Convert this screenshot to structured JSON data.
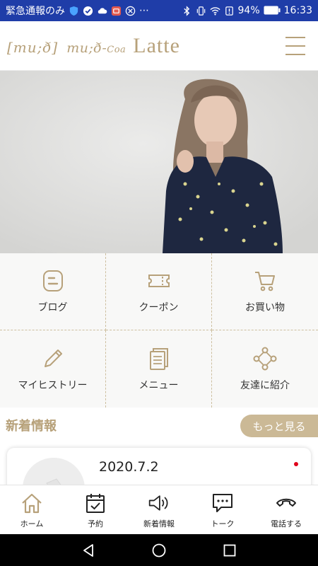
{
  "status_bar": {
    "left_text": "緊急通報のみ",
    "more": "⋯",
    "battery": "94%",
    "time": "16:33"
  },
  "header": {
    "brand1": "[mu;ð]",
    "brand2_main": "mu;ð-",
    "brand2_small": "Coa",
    "brand3": "Latte"
  },
  "grid": {
    "items": [
      {
        "label": "ブログ",
        "icon": "blog-icon"
      },
      {
        "label": "クーポン",
        "icon": "coupon-icon"
      },
      {
        "label": "お買い物",
        "icon": "cart-icon"
      },
      {
        "label": "マイヒストリー",
        "icon": "pencil-icon"
      },
      {
        "label": "メニュー",
        "icon": "menu-book-icon"
      },
      {
        "label": "友達に紹介",
        "icon": "share-network-icon"
      }
    ]
  },
  "news": {
    "title": "新着情報",
    "more_label": "もっと見る",
    "items": [
      {
        "date": "2020.7.2"
      }
    ]
  },
  "bottom_nav": {
    "items": [
      {
        "label": "ホーム",
        "icon": "home-icon"
      },
      {
        "label": "予約",
        "icon": "calendar-icon"
      },
      {
        "label": "新着情報",
        "icon": "megaphone-icon"
      },
      {
        "label": "トーク",
        "icon": "chat-icon"
      },
      {
        "label": "電話する",
        "icon": "phone-icon"
      }
    ]
  },
  "colors": {
    "accent": "#b7a17a",
    "status_bar": "#1f3da8",
    "more_button": "#cbb996",
    "unread_dot": "#e0001a"
  }
}
